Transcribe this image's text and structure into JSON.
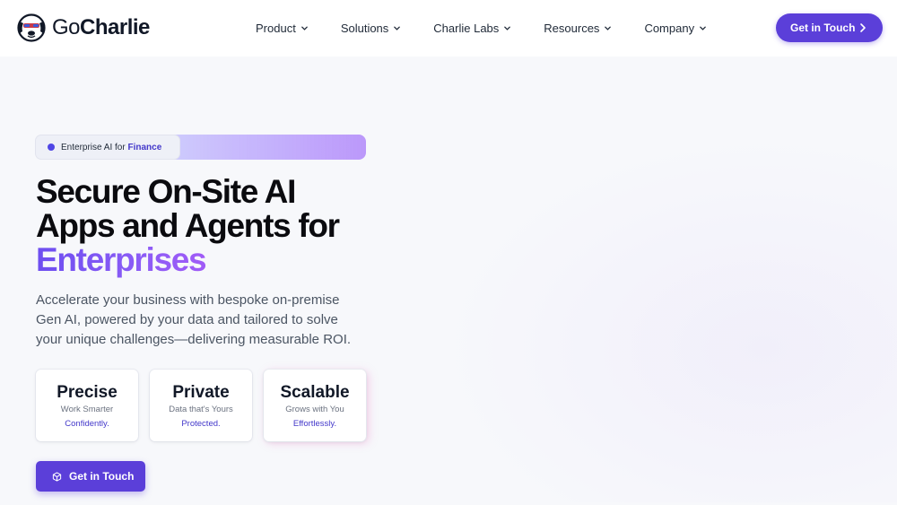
{
  "brand": {
    "name_prefix": "Go",
    "name_suffix": "Charlie",
    "logo_icon": "dog-face-logo-icon",
    "accent_color": "#5b3fd9"
  },
  "nav": {
    "items": [
      {
        "label": "Product"
      },
      {
        "label": "Solutions"
      },
      {
        "label": "Charlie Labs"
      },
      {
        "label": "Resources"
      },
      {
        "label": "Company"
      }
    ],
    "cta_label": "Get in Touch",
    "cta_icon": "chevron-right-icon"
  },
  "hero": {
    "badge_prefix": "Enterprise AI for ",
    "badge_highlight": "Finance",
    "headline_line1": "Secure On-Site AI",
    "headline_line2": "Apps and Agents for",
    "headline_highlight": "Enterprises",
    "subtext": "Accelerate your business with bespoke on-premise Gen AI, powered by your data and tailored to solve your unique challenges—delivering measurable ROI.",
    "cards": [
      {
        "title": "Precise",
        "subtitle": "Work Smarter",
        "accent": "Confidently."
      },
      {
        "title": "Private",
        "subtitle": "Data that's Yours",
        "accent": "Protected."
      },
      {
        "title": "Scalable",
        "subtitle": "Grows with You",
        "accent": "Effortlessly."
      }
    ],
    "cta_label": "Get in Touch",
    "cta_icon": "cube-icon"
  }
}
